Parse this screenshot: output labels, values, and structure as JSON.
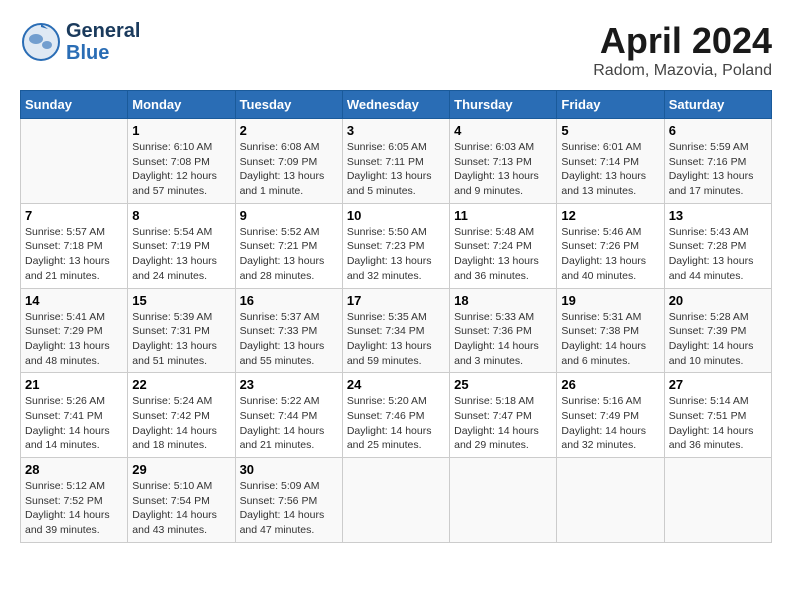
{
  "header": {
    "logo_general": "General",
    "logo_blue": "Blue",
    "title": "April 2024",
    "subtitle": "Radom, Mazovia, Poland"
  },
  "days_of_week": [
    "Sunday",
    "Monday",
    "Tuesday",
    "Wednesday",
    "Thursday",
    "Friday",
    "Saturday"
  ],
  "weeks": [
    [
      {
        "day": "",
        "info": ""
      },
      {
        "day": "1",
        "info": "Sunrise: 6:10 AM\nSunset: 7:08 PM\nDaylight: 12 hours\nand 57 minutes."
      },
      {
        "day": "2",
        "info": "Sunrise: 6:08 AM\nSunset: 7:09 PM\nDaylight: 13 hours\nand 1 minute."
      },
      {
        "day": "3",
        "info": "Sunrise: 6:05 AM\nSunset: 7:11 PM\nDaylight: 13 hours\nand 5 minutes."
      },
      {
        "day": "4",
        "info": "Sunrise: 6:03 AM\nSunset: 7:13 PM\nDaylight: 13 hours\nand 9 minutes."
      },
      {
        "day": "5",
        "info": "Sunrise: 6:01 AM\nSunset: 7:14 PM\nDaylight: 13 hours\nand 13 minutes."
      },
      {
        "day": "6",
        "info": "Sunrise: 5:59 AM\nSunset: 7:16 PM\nDaylight: 13 hours\nand 17 minutes."
      }
    ],
    [
      {
        "day": "7",
        "info": "Sunrise: 5:57 AM\nSunset: 7:18 PM\nDaylight: 13 hours\nand 21 minutes."
      },
      {
        "day": "8",
        "info": "Sunrise: 5:54 AM\nSunset: 7:19 PM\nDaylight: 13 hours\nand 24 minutes."
      },
      {
        "day": "9",
        "info": "Sunrise: 5:52 AM\nSunset: 7:21 PM\nDaylight: 13 hours\nand 28 minutes."
      },
      {
        "day": "10",
        "info": "Sunrise: 5:50 AM\nSunset: 7:23 PM\nDaylight: 13 hours\nand 32 minutes."
      },
      {
        "day": "11",
        "info": "Sunrise: 5:48 AM\nSunset: 7:24 PM\nDaylight: 13 hours\nand 36 minutes."
      },
      {
        "day": "12",
        "info": "Sunrise: 5:46 AM\nSunset: 7:26 PM\nDaylight: 13 hours\nand 40 minutes."
      },
      {
        "day": "13",
        "info": "Sunrise: 5:43 AM\nSunset: 7:28 PM\nDaylight: 13 hours\nand 44 minutes."
      }
    ],
    [
      {
        "day": "14",
        "info": "Sunrise: 5:41 AM\nSunset: 7:29 PM\nDaylight: 13 hours\nand 48 minutes."
      },
      {
        "day": "15",
        "info": "Sunrise: 5:39 AM\nSunset: 7:31 PM\nDaylight: 13 hours\nand 51 minutes."
      },
      {
        "day": "16",
        "info": "Sunrise: 5:37 AM\nSunset: 7:33 PM\nDaylight: 13 hours\nand 55 minutes."
      },
      {
        "day": "17",
        "info": "Sunrise: 5:35 AM\nSunset: 7:34 PM\nDaylight: 13 hours\nand 59 minutes."
      },
      {
        "day": "18",
        "info": "Sunrise: 5:33 AM\nSunset: 7:36 PM\nDaylight: 14 hours\nand 3 minutes."
      },
      {
        "day": "19",
        "info": "Sunrise: 5:31 AM\nSunset: 7:38 PM\nDaylight: 14 hours\nand 6 minutes."
      },
      {
        "day": "20",
        "info": "Sunrise: 5:28 AM\nSunset: 7:39 PM\nDaylight: 14 hours\nand 10 minutes."
      }
    ],
    [
      {
        "day": "21",
        "info": "Sunrise: 5:26 AM\nSunset: 7:41 PM\nDaylight: 14 hours\nand 14 minutes."
      },
      {
        "day": "22",
        "info": "Sunrise: 5:24 AM\nSunset: 7:42 PM\nDaylight: 14 hours\nand 18 minutes."
      },
      {
        "day": "23",
        "info": "Sunrise: 5:22 AM\nSunset: 7:44 PM\nDaylight: 14 hours\nand 21 minutes."
      },
      {
        "day": "24",
        "info": "Sunrise: 5:20 AM\nSunset: 7:46 PM\nDaylight: 14 hours\nand 25 minutes."
      },
      {
        "day": "25",
        "info": "Sunrise: 5:18 AM\nSunset: 7:47 PM\nDaylight: 14 hours\nand 29 minutes."
      },
      {
        "day": "26",
        "info": "Sunrise: 5:16 AM\nSunset: 7:49 PM\nDaylight: 14 hours\nand 32 minutes."
      },
      {
        "day": "27",
        "info": "Sunrise: 5:14 AM\nSunset: 7:51 PM\nDaylight: 14 hours\nand 36 minutes."
      }
    ],
    [
      {
        "day": "28",
        "info": "Sunrise: 5:12 AM\nSunset: 7:52 PM\nDaylight: 14 hours\nand 39 minutes."
      },
      {
        "day": "29",
        "info": "Sunrise: 5:10 AM\nSunset: 7:54 PM\nDaylight: 14 hours\nand 43 minutes."
      },
      {
        "day": "30",
        "info": "Sunrise: 5:09 AM\nSunset: 7:56 PM\nDaylight: 14 hours\nand 47 minutes."
      },
      {
        "day": "",
        "info": ""
      },
      {
        "day": "",
        "info": ""
      },
      {
        "day": "",
        "info": ""
      },
      {
        "day": "",
        "info": ""
      }
    ]
  ]
}
